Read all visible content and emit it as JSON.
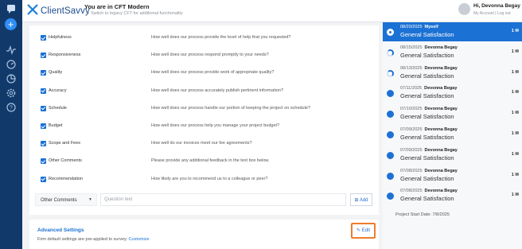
{
  "header": {
    "logo_text": "ClientSavvy",
    "env_title": "You are in CFT Modern",
    "env_sub": "Switch to legacy CFT for additional functionality",
    "greeting": "Hi, Devonna Begay",
    "my_account": "My Account",
    "separator": " | ",
    "log_out": "Log out"
  },
  "rows": [
    {
      "label": "Helpfulness",
      "question": "How well does our process provide the level of help that you requested?"
    },
    {
      "label": "Responsiveness",
      "question": "How well does our process respond promptly to your needs?"
    },
    {
      "label": "Quality",
      "question": "How well does our process provide work of appropriate quality?"
    },
    {
      "label": "Accuracy",
      "question": "How well does our process accurately publish pertinent information?"
    },
    {
      "label": "Schedule",
      "question": "How well does our process handle our portion of keeping the project on schedule?"
    },
    {
      "label": "Budget",
      "question": "How well does our process help you manage your project budget?"
    },
    {
      "label": "Scope and Fees",
      "question": "How well do our invoices meet our fee agreements?"
    },
    {
      "label": "Other Comments",
      "question": "Please provide any additional feedback in the text box below."
    },
    {
      "label": "Recommendation",
      "question": "How likely are you to recommend us to a colleague or peer?"
    }
  ],
  "add_question": {
    "select_value": "Other Comments",
    "placeholder": "Question text",
    "add_label": "Add"
  },
  "advanced": {
    "title": "Advanced Settings",
    "desc": "Firm default settings are pre-applied to survey.",
    "customize": "Customize",
    "edit": "Edit"
  },
  "surveys": [
    {
      "date": "08/20/2025",
      "name": "Myself",
      "survey": "General Satisfaction",
      "count": "1",
      "status": "active"
    },
    {
      "date": "08/15/2025",
      "name": "Devonna Begay",
      "survey": "General Satisfaction",
      "count": "1",
      "status": "partial"
    },
    {
      "date": "08/13/2025",
      "name": "Devonna Begay",
      "survey": "General Satisfaction",
      "count": "1",
      "status": "partial"
    },
    {
      "date": "07/11/2025",
      "name": "Devonna Begay",
      "survey": "General Satisfaction",
      "count": "1",
      "status": "complete"
    },
    {
      "date": "07/10/2025",
      "name": "Devonna Begay",
      "survey": "General Satisfaction",
      "count": "1",
      "status": "complete"
    },
    {
      "date": "07/09/2025",
      "name": "Devonna Begay",
      "survey": "General Satisfaction",
      "count": "1",
      "status": "complete"
    },
    {
      "date": "07/09/2025",
      "name": "Devonna Begay",
      "survey": "General Satisfaction",
      "count": "1",
      "status": "complete"
    },
    {
      "date": "07/08/2025",
      "name": "Devonna Begay",
      "survey": "General Satisfaction",
      "count": "1",
      "status": "complete"
    },
    {
      "date": "07/08/2025",
      "name": "Devonna Begay",
      "survey": "General Satisfaction",
      "count": "1",
      "status": "complete"
    }
  ],
  "project_start": "Project Start Date: 7/8/2025",
  "colors": {
    "accent": "#1c71d4",
    "rail": "#113a6b",
    "highlight": "#f07c2c"
  }
}
